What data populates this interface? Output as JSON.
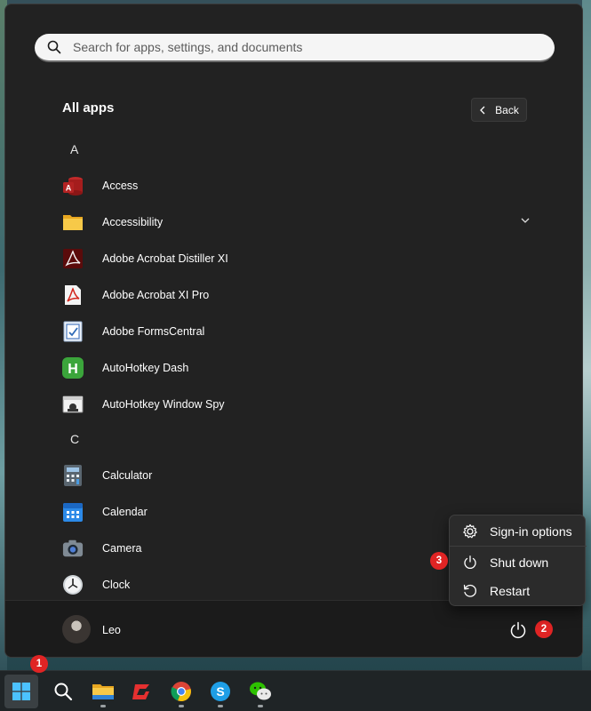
{
  "search": {
    "placeholder": "Search for apps, settings, and documents"
  },
  "all_apps": {
    "title": "All apps",
    "back_label": "Back"
  },
  "sections": [
    {
      "letter": "A",
      "apps": [
        {
          "label": "Access",
          "icon": "access-icon"
        },
        {
          "label": "Accessibility",
          "icon": "folder-icon",
          "expandable": true
        },
        {
          "label": "Adobe Acrobat Distiller XI",
          "icon": "acrobat-distiller-icon"
        },
        {
          "label": "Adobe Acrobat XI Pro",
          "icon": "acrobat-pro-icon"
        },
        {
          "label": "Adobe FormsCentral",
          "icon": "formscentral-icon"
        },
        {
          "label": "AutoHotkey Dash",
          "icon": "autohotkey-dash-icon"
        },
        {
          "label": "AutoHotkey Window Spy",
          "icon": "autohotkey-spy-icon"
        }
      ]
    },
    {
      "letter": "C",
      "apps": [
        {
          "label": "Calculator",
          "icon": "calculator-icon"
        },
        {
          "label": "Calendar",
          "icon": "calendar-icon"
        },
        {
          "label": "Camera",
          "icon": "camera-icon"
        },
        {
          "label": "Clock",
          "icon": "clock-icon"
        }
      ]
    }
  ],
  "user": {
    "name": "Leo"
  },
  "power_menu": {
    "items": [
      {
        "label": "Sign-in options",
        "icon": "gear-icon"
      },
      {
        "label": "Shut down",
        "icon": "power-icon"
      },
      {
        "label": "Restart",
        "icon": "restart-icon"
      }
    ]
  },
  "badges": [
    "1",
    "2",
    "3"
  ],
  "taskbar": {
    "items": [
      {
        "name": "start",
        "icon": "windows-logo-icon",
        "active": true
      },
      {
        "name": "search",
        "icon": "search-icon"
      },
      {
        "name": "file-explorer",
        "icon": "folder-icon",
        "running": true
      },
      {
        "name": "app-red",
        "icon": "red-app-icon"
      },
      {
        "name": "chrome",
        "icon": "chrome-icon",
        "running": true
      },
      {
        "name": "skype",
        "icon": "skype-icon",
        "running": true
      },
      {
        "name": "wechat",
        "icon": "wechat-icon",
        "running": true
      }
    ]
  },
  "colors": {
    "accent_badge": "#e02424",
    "panel": "#222222",
    "taskbar": "#1f2426"
  }
}
